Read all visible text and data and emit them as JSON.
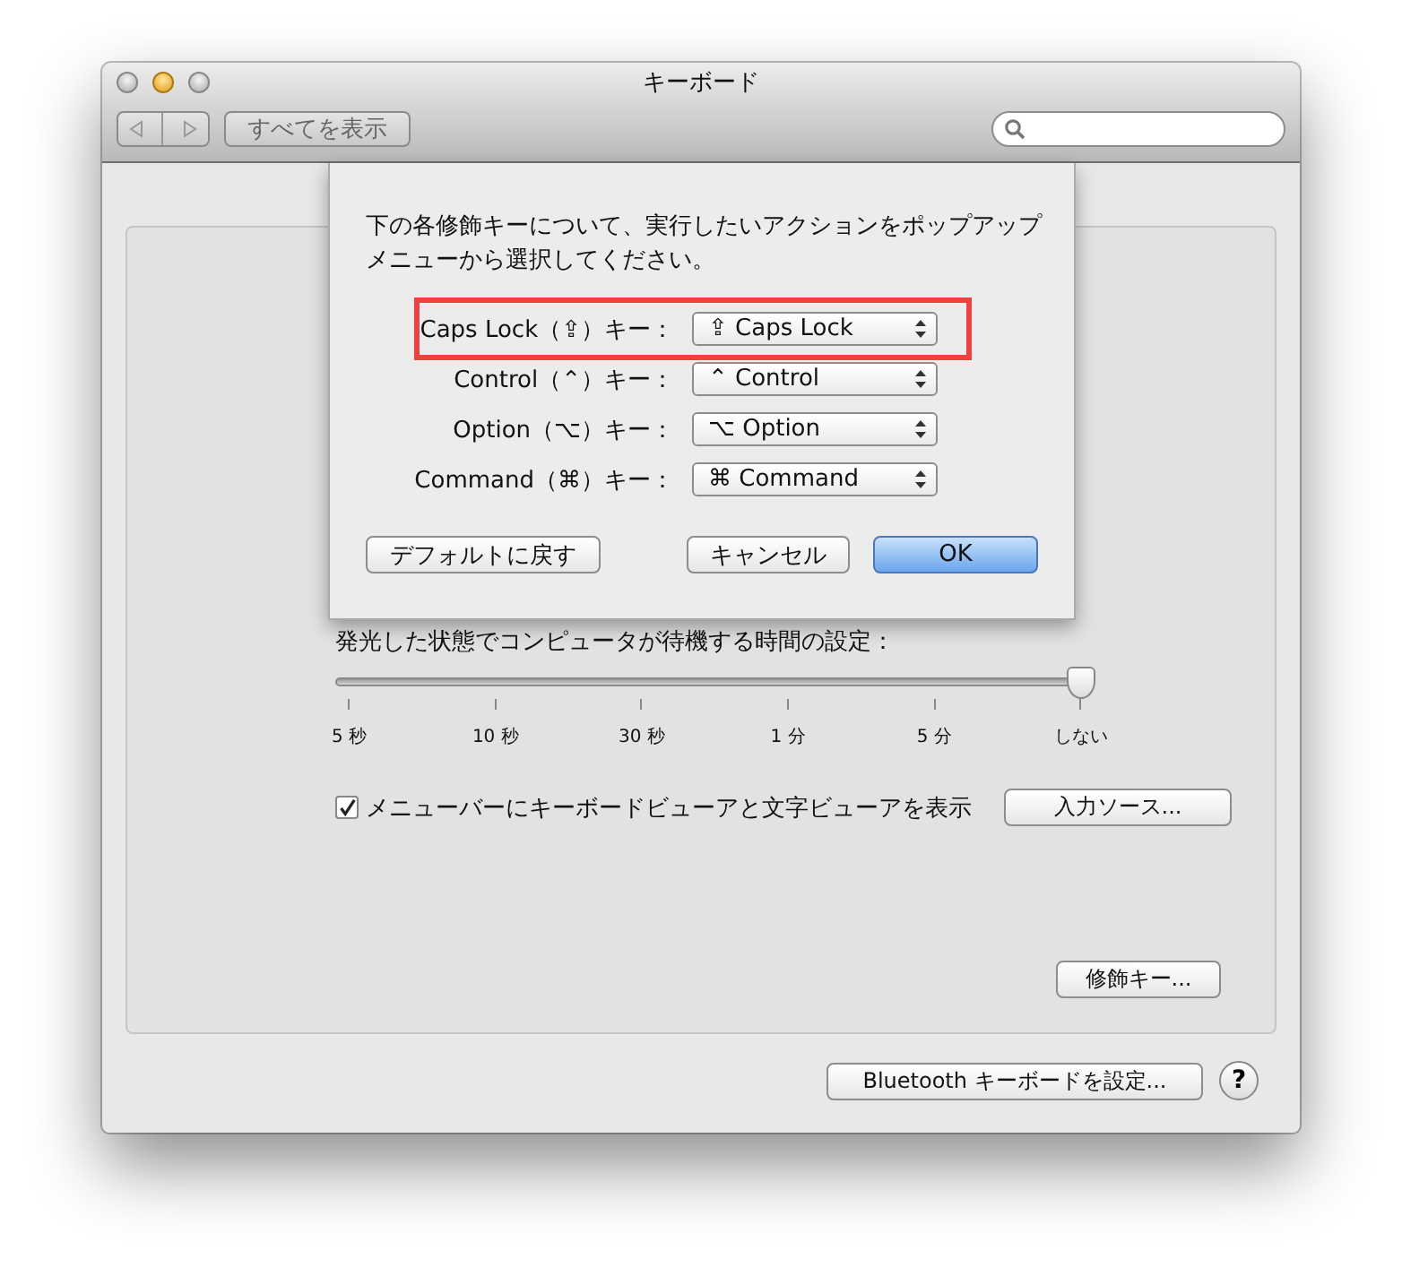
{
  "window": {
    "title": "キーボード"
  },
  "toolbar": {
    "show_all_button": "すべてを表示"
  },
  "modifier_sheet": {
    "instructions": "下の各修飾キーについて、実行したいアクションをポップアップメニューから選択してください。",
    "rows": [
      {
        "label": "Caps Lock（⇪）キー：",
        "value": "⇪ Caps Lock",
        "highlighted": true
      },
      {
        "label": "Control（⌃）キー：",
        "value": "⌃ Control",
        "highlighted": false
      },
      {
        "label": "Option（⌥）キー：",
        "value": "⌥ Option",
        "highlighted": false
      },
      {
        "label": "Command（⌘）キー：",
        "value": "⌘ Command",
        "highlighted": false
      }
    ],
    "buttons": [
      {
        "label": "デフォルトに戻す",
        "kind": "plain"
      },
      {
        "label": "キャンセル",
        "kind": "plain"
      },
      {
        "label": "OK",
        "kind": "default"
      }
    ]
  },
  "backlight": {
    "label": "発光した状態でコンピュータが待機する時間の設定：",
    "slider": {
      "level": 1.0
    },
    "ticks": [
      "5 秒",
      "10 秒",
      "30 秒",
      "1 分",
      "5 分",
      "しない"
    ]
  },
  "menu_checkbox": {
    "label": "メニューバーにキーボードビューアと文字ビューアを表示",
    "checked": true
  },
  "input_sources_button": "入力ソース...",
  "modifier_keys_button": "修飾キー...",
  "bluetooth_button": "Bluetooth キーボードを設定...",
  "help_button": "?"
}
